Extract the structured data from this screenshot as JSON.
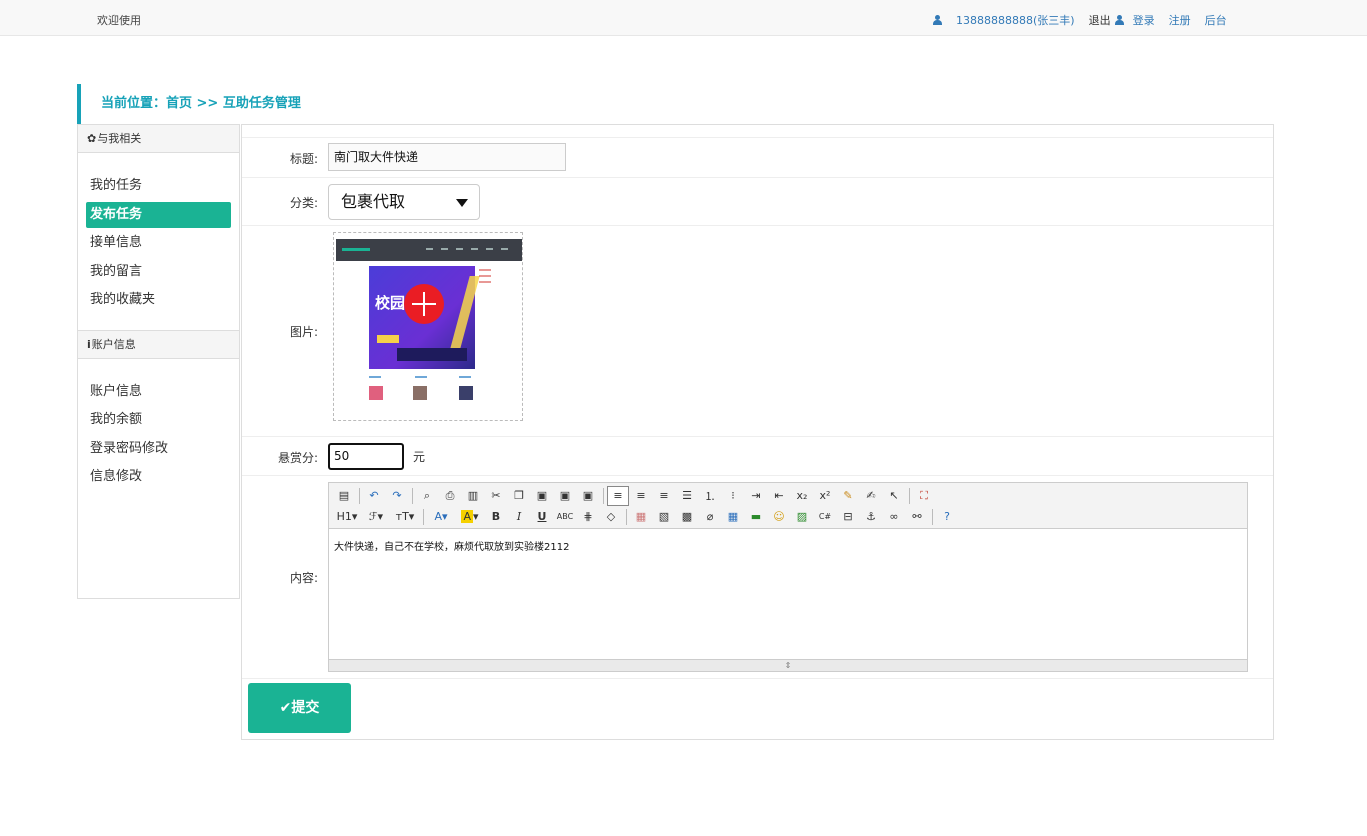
{
  "topbar": {
    "welcome": "欢迎使用",
    "username": "13888888888(张三丰)",
    "logout": "退出",
    "login": "登录",
    "register": "注册",
    "admin": "后台"
  },
  "breadcrumb": "当前位置：首页 >> 互助任务管理",
  "sidebar": {
    "section1_title": "与我相关",
    "section1_icon": "gear-icon",
    "section1_items": [
      "我的任务",
      "发布任务",
      "接单信息",
      "我的留言",
      "我的收藏夹"
    ],
    "active_item": "发布任务",
    "section2_title": "账户信息",
    "section2_icon": "info-icon",
    "section2_items": [
      "账户信息",
      "我的余额",
      "登录密码修改",
      "信息修改"
    ]
  },
  "form": {
    "title_label": "标题:",
    "title_value": "南门取大件快递",
    "category_label": "分类:",
    "category_value": "包裹代取",
    "image_label": "图片:",
    "reward_label": "悬赏分:",
    "reward_value": "50",
    "reward_unit": "元",
    "content_label": "内容:",
    "content_value": "大件快递，自己不在学校，麻烦代取放到实验楼2112",
    "submit_label": "提交",
    "accent_color": "#1ab394",
    "brand_color": "#17a2b8"
  },
  "thumbnail": {
    "banner_text": "校园"
  }
}
